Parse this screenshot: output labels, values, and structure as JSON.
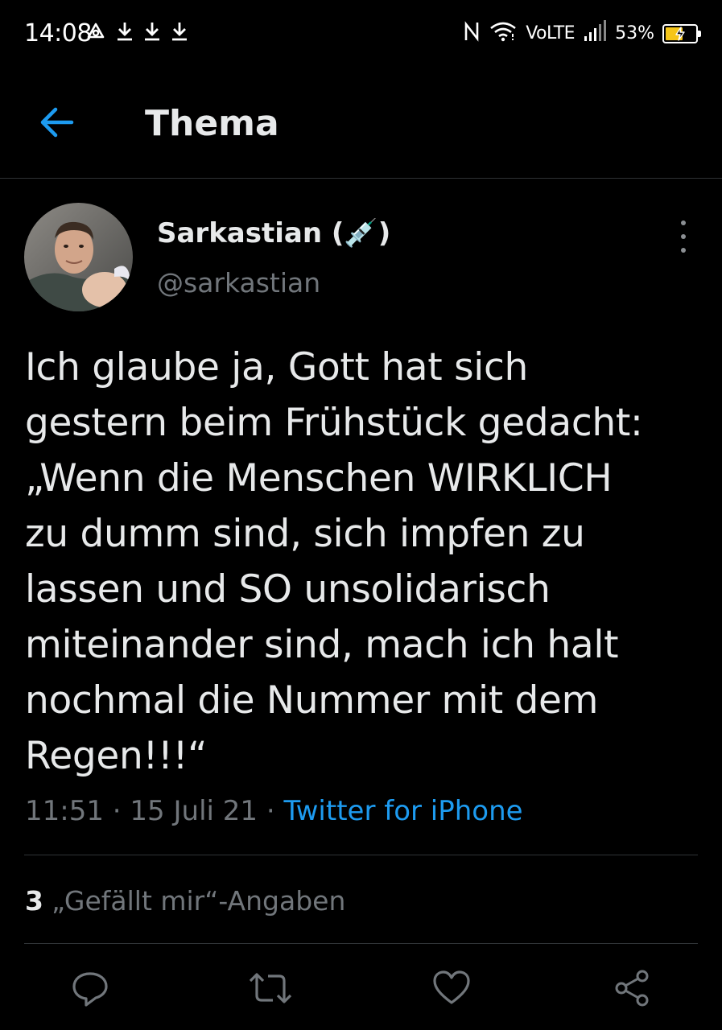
{
  "status_bar": {
    "time": "14:08",
    "network": "VoLTE",
    "battery_percent": "53%",
    "battery_level": 0.53,
    "left_icons": [
      "sync-icon",
      "download-icon",
      "download-icon",
      "download-icon"
    ],
    "right_icons": [
      "nfc-icon",
      "wifi-icon",
      "signal-icon",
      "battery-icon"
    ]
  },
  "header": {
    "title": "Thema",
    "back_icon": "arrow-left-icon"
  },
  "tweet": {
    "author_name": "Sarkastian (💉)",
    "author_handle": "@sarkastian",
    "text": "Ich glaube ja, Gott hat sich\ngestern beim Frühstück gedacht:\n„Wenn die Menschen WIRKLICH\nzu dumm sind, sich impfen zu\nlassen und SO unsolidarisch\nmiteinander sind, mach ich halt\nnochmal die Nummer mit dem\nRegen!!!“",
    "time": "11:51",
    "separator": "·",
    "date": "15 Juli 21",
    "source": "Twitter for iPhone",
    "likes_count": "3",
    "likes_label": "„Gefällt mir“-Angaben"
  },
  "actions": [
    {
      "name": "reply",
      "icon": "reply-icon"
    },
    {
      "name": "retweet",
      "icon": "retweet-icon"
    },
    {
      "name": "like",
      "icon": "heart-icon"
    },
    {
      "name": "share",
      "icon": "share-icon"
    }
  ],
  "colors": {
    "background": "#000000",
    "text": "#e7e9ea",
    "secondary_text": "#71767b",
    "accent": "#1d9bf0",
    "divider": "#2f3336"
  }
}
